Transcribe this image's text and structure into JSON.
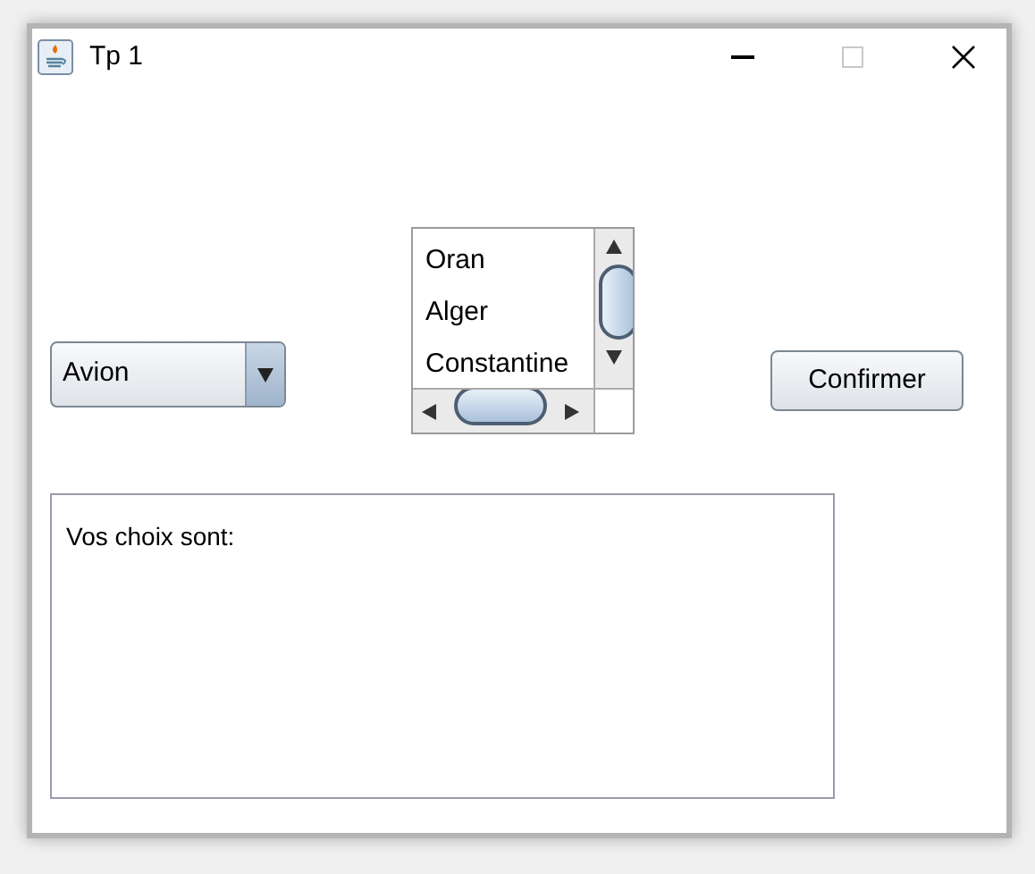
{
  "window": {
    "title": "Tp 1"
  },
  "combo": {
    "value": "Avion"
  },
  "list": {
    "items": [
      "Oran",
      "Alger",
      "Constantine"
    ]
  },
  "button": {
    "label": "Confirmer"
  },
  "output": {
    "text": "Vos choix sont:"
  }
}
